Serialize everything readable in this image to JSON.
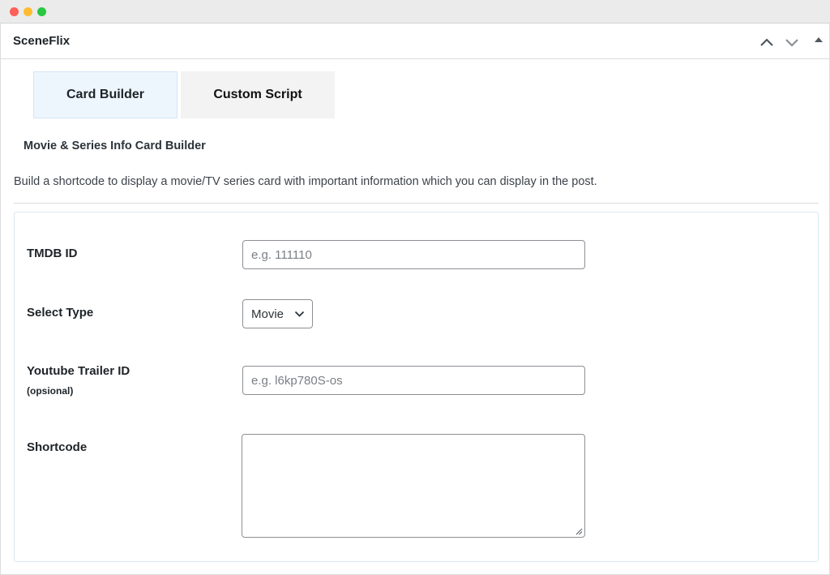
{
  "window": {
    "controls": [
      "close",
      "minimize",
      "maximize"
    ]
  },
  "postbox": {
    "title": "SceneFlix",
    "header_buttons": [
      "chevron-up-icon",
      "chevron-down-icon",
      "triangle-up-icon"
    ]
  },
  "tabs": [
    {
      "label": "Card Builder",
      "active": true
    },
    {
      "label": "Custom Script",
      "active": false
    }
  ],
  "section": {
    "title": "Movie & Series Info Card Builder",
    "description": "Build a shortcode to display a movie/TV series card with important information which you can display in the post."
  },
  "form": {
    "tmdb": {
      "label": "TMDB ID",
      "placeholder": "e.g. 111110",
      "value": ""
    },
    "type": {
      "label": "Select Type",
      "selected": "Movie"
    },
    "trailer": {
      "label": "Youtube Trailer ID",
      "sublabel": "(opsional)",
      "placeholder": "e.g. l6kp780S-os",
      "value": ""
    },
    "shortcode": {
      "label": "Shortcode",
      "value": ""
    }
  },
  "colors": {
    "active_tab_bg": "#eef6fd",
    "inactive_tab_bg": "#f3f3f3",
    "input_border": "#8c8f94"
  }
}
